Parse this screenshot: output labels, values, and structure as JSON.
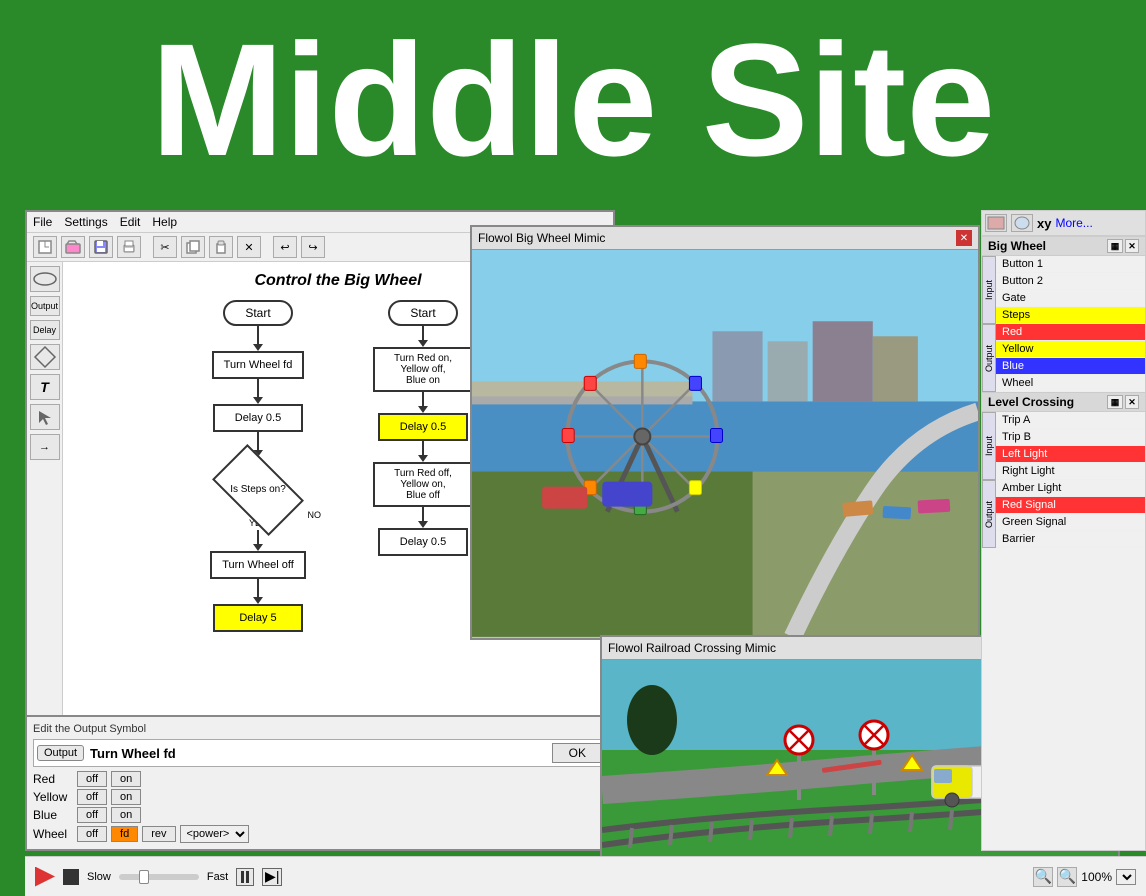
{
  "title": "Middle Site",
  "app": {
    "menu": [
      "File",
      "Settings",
      "Edit",
      "Help"
    ],
    "flow_title": "Control the Big Wheel",
    "left_column": {
      "nodes": [
        {
          "type": "oval",
          "text": "Start"
        },
        {
          "type": "rect",
          "text": "Turn Wheel fd"
        },
        {
          "type": "rect",
          "text": "Delay 0.5"
        },
        {
          "type": "diamond",
          "text": "Is Steps on?"
        },
        {
          "type": "label_no",
          "text": "NO"
        },
        {
          "type": "label_yes",
          "text": "YES"
        },
        {
          "type": "rect",
          "text": "Turn Wheel off"
        },
        {
          "type": "rect",
          "text": "Delay 5",
          "yellow": true
        }
      ]
    },
    "right_column": {
      "nodes": [
        {
          "type": "oval",
          "text": "Start"
        },
        {
          "type": "rect",
          "text": "Turn Red on, Yellow off, Blue on"
        },
        {
          "type": "rect",
          "text": "Delay 0.5",
          "yellow": true
        },
        {
          "type": "rect",
          "text": "Turn Red off, Yellow on, Blue off"
        },
        {
          "type": "rect",
          "text": "Delay 0.5"
        }
      ]
    },
    "edit_panel": {
      "title": "Edit the Output Symbol",
      "output_badge": "Output",
      "name": "Turn Wheel fd",
      "ok_label": "OK",
      "rows": [
        {
          "label": "Red",
          "off": "off",
          "on": "on"
        },
        {
          "label": "Yellow",
          "off": "off",
          "on": "on"
        },
        {
          "label": "Blue",
          "off": "off",
          "on": "on"
        },
        {
          "label": "Wheel",
          "off": "off",
          "fd": "fd",
          "rev": "rev",
          "power": "<power>"
        }
      ]
    }
  },
  "big_wheel_mimic": {
    "title": "Flowol Big Wheel Mimic"
  },
  "railroad_mimic": {
    "title": "Flowol Railroad Crossing Mimic"
  },
  "right_panel": {
    "xy_label": "xy",
    "more_label": "More...",
    "big_wheel_section": "Big Wheel",
    "big_wheel_rows": [
      {
        "label": "Button 1",
        "colored": false
      },
      {
        "label": "Button 2",
        "colored": false
      },
      {
        "label": "Gate",
        "colored": false
      },
      {
        "label": "Steps",
        "colored": "yellow"
      },
      {
        "label": "Red",
        "colored": "red"
      },
      {
        "label": "Yellow",
        "colored": "yellow"
      },
      {
        "label": "Blue",
        "colored": "blue"
      },
      {
        "label": "Wheel",
        "colored": false
      }
    ],
    "level_crossing_section": "Level Crossing",
    "level_crossing_rows": [
      {
        "label": "Trip A",
        "colored": false
      },
      {
        "label": "Trip B",
        "colored": false
      },
      {
        "label": "Left Light",
        "colored": "red"
      },
      {
        "label": "Right Light",
        "colored": false
      },
      {
        "label": "Amber Light",
        "colored": false
      },
      {
        "label": "Red Signal",
        "colored": "red"
      },
      {
        "label": "Green Signal",
        "colored": false
      },
      {
        "label": "Barrier",
        "colored": false
      }
    ]
  },
  "bottom_bar": {
    "slow_label": "Slow",
    "fast_label": "Fast",
    "zoom_label": "100%"
  }
}
